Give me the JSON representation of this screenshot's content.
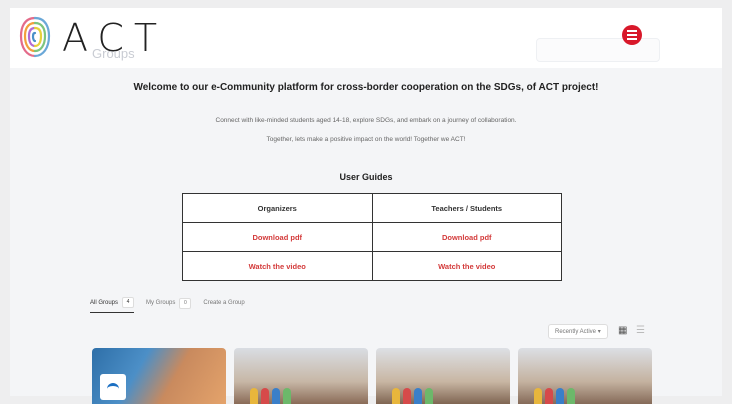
{
  "brand": {
    "logo_text": "ACT"
  },
  "header": {
    "faded_title": "Groups"
  },
  "intro": {
    "welcome": "Welcome to our e-Community platform for cross-border cooperation on the SDGs, of ACT project!",
    "line1": "Connect with like-minded students aged 14-18, explore SDGs, and embark on a journey of collaboration.",
    "line2": "Together, lets make a positive impact on the world! Together we ACT!"
  },
  "guides": {
    "title": "User Guides",
    "columns": [
      "Organizers",
      "Teachers / Students"
    ],
    "rows": [
      [
        "Download pdf",
        "Download pdf"
      ],
      [
        "Watch the video",
        "Watch the video"
      ]
    ]
  },
  "tabs": [
    {
      "label": "All Groups",
      "count": "4"
    },
    {
      "label": "My Groups",
      "count": "0"
    },
    {
      "label": "Create a Group"
    }
  ],
  "sort": {
    "selected": "Recently Active"
  },
  "colors": {
    "accent": "#d8182a",
    "link": "#d33a3a",
    "brand_blue": "#1b6fc2"
  },
  "icons": {
    "menu": "hamburger-icon",
    "grid": "grid-view-icon",
    "list": "list-view-icon",
    "logo": "fingerprint-logo-icon"
  }
}
